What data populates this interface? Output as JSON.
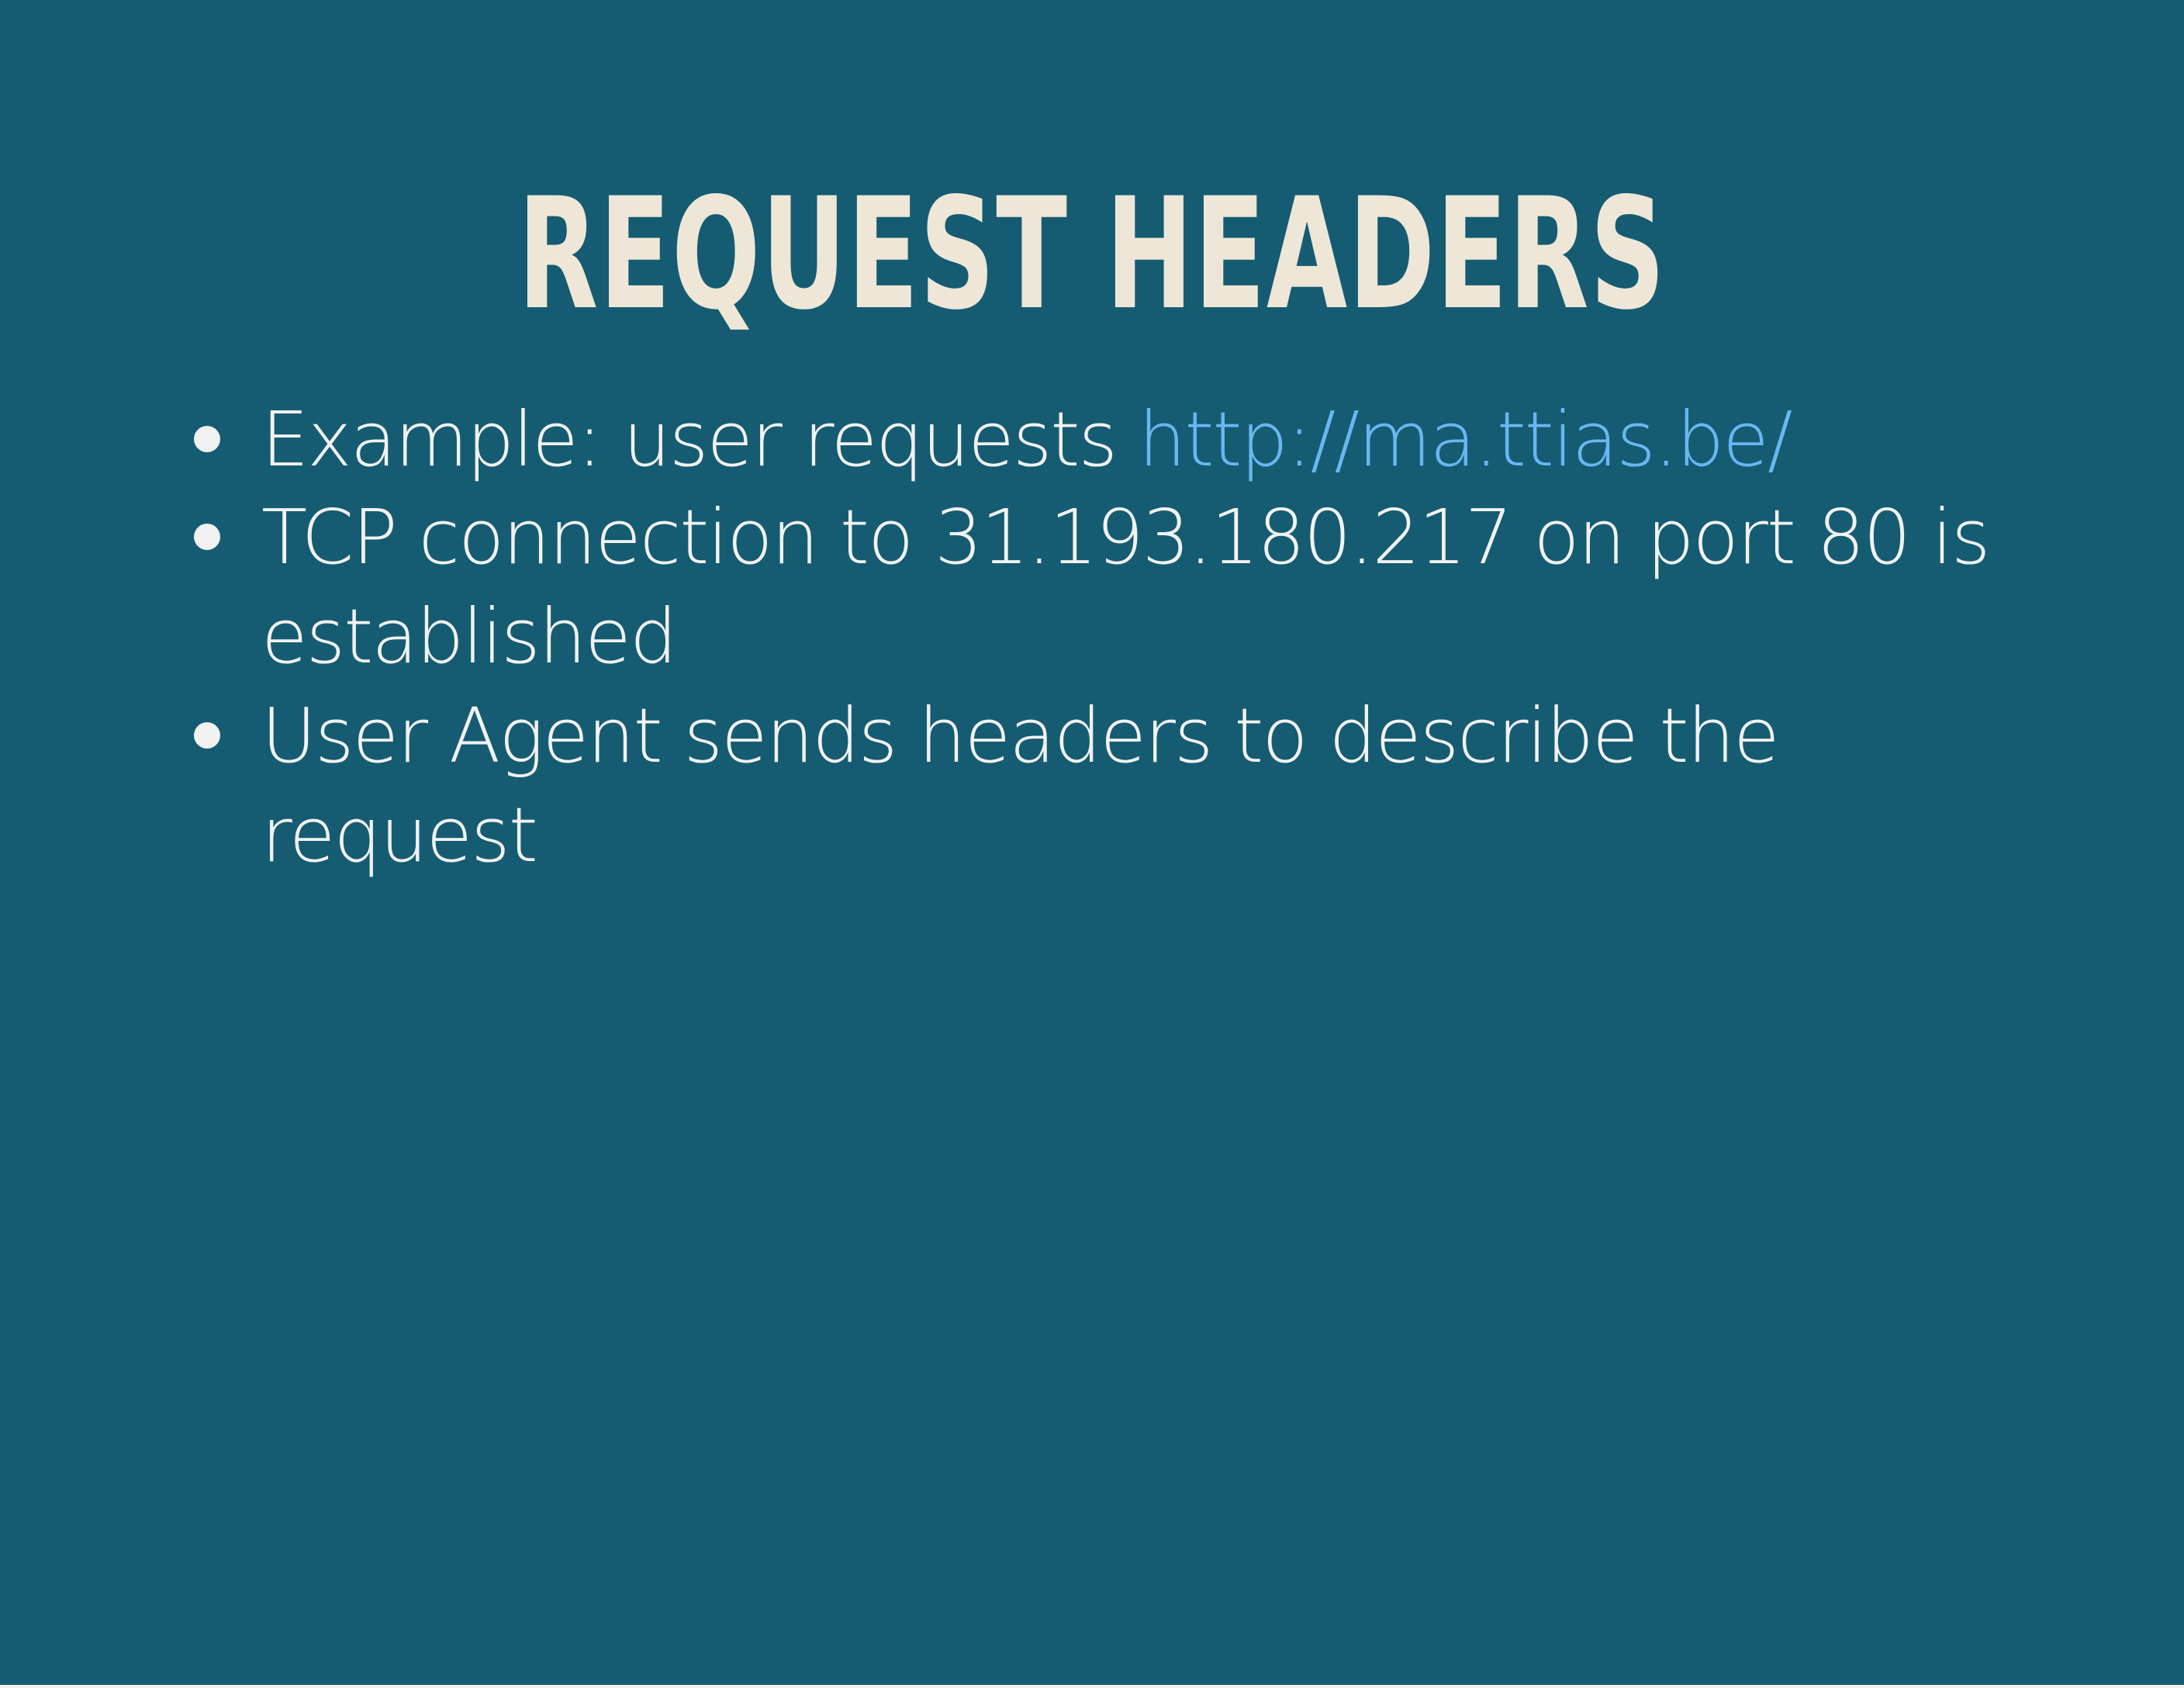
{
  "slide": {
    "title": "REQUEST HEADERS",
    "bullets": [
      {
        "text": "Example: user requests ",
        "link": "http://ma.ttias.be/"
      },
      {
        "line1": "TCP connection to 31.193.180.217 on port 80 is",
        "line2": "established"
      },
      {
        "line1": "User Agent sends headers to describe the",
        "line2": "request"
      }
    ]
  },
  "colors": {
    "background": "#155c72",
    "title": "#eee7d7",
    "text": "#f2f2f2",
    "link": "#6ab6f2"
  }
}
